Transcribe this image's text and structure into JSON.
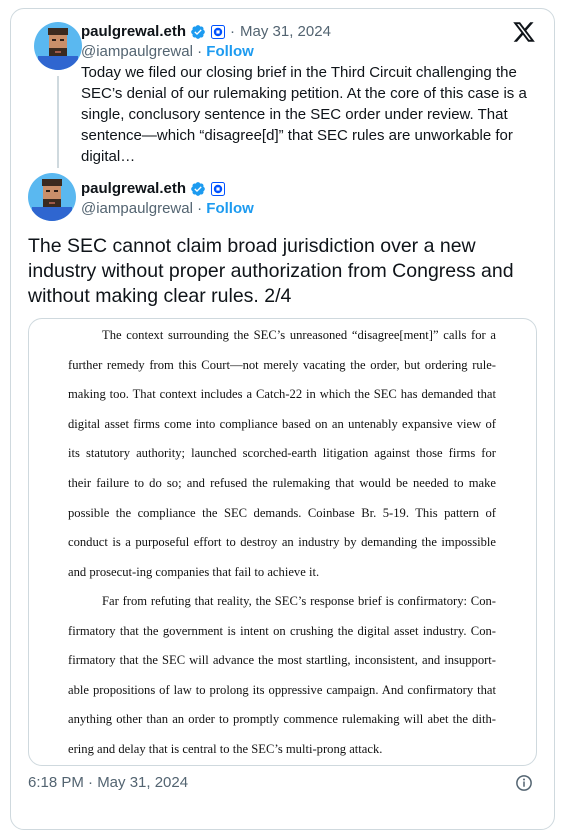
{
  "quoted_tweet": {
    "name": "paulgrewal.eth",
    "handle": "@iampaulgrewal",
    "date": "May 31, 2024",
    "follow_label": "Follow",
    "text": "Today we filed our closing brief in the Third Circuit challenging the SEC’s denial of our rulemaking petition. At the core of this case is a single, conclusory sentence in the SEC order under review. That sentence—which “disagree[d]” that SEC rules are unworkable for digital…"
  },
  "main_tweet": {
    "name": "paulgrewal.eth",
    "handle": "@iampaulgrewal",
    "follow_label": "Follow",
    "text": "The SEC cannot claim broad jurisdiction over a new industry without proper authorization from Congress and without making clear rules. 2/4",
    "timestamp": "6:18 PM · May 31, 2024"
  },
  "separator": "·",
  "attached_document": {
    "paragraphs": [
      "The context surrounding the SEC’s unreasoned “disagree[ment]” calls for a further remedy from this Court—not merely vacating the order, but ordering rule-making too. That context includes a Catch-22 in which the SEC has demanded that digital asset firms come into compliance based on an untenably expansive view of its statutory authority; launched scorched-earth litigation against those firms for their failure to do so; and refused the rulemaking that would be needed to make possible the compliance the SEC demands. Coinbase Br. 5-19. This pattern of conduct is a purposeful effort to destroy an industry by demanding the impossible and prosecut-ing companies that fail to achieve it.",
      "Far from refuting that reality, the SEC’s response brief is confirmatory: Con-firmatory that the government is intent on crushing the digital asset industry. Con-firmatory that the SEC will advance the most startling, inconsistent, and insupport-able propositions of law to prolong its oppressive campaign. And confirmatory that anything other than an order to promptly commence rulemaking will abet the dith-ering and delay that is central to the SEC’s multi-prong attack."
    ]
  },
  "icons": {
    "verified": "verified-badge-icon",
    "affiliate": "coinbase-affiliate-icon",
    "platform": "x-logo-icon",
    "info": "info-icon"
  },
  "colors": {
    "accent": "#1d9bf0",
    "secondary_text": "#536471",
    "border": "#cfd9de",
    "affiliate_blue": "#0052ff"
  }
}
